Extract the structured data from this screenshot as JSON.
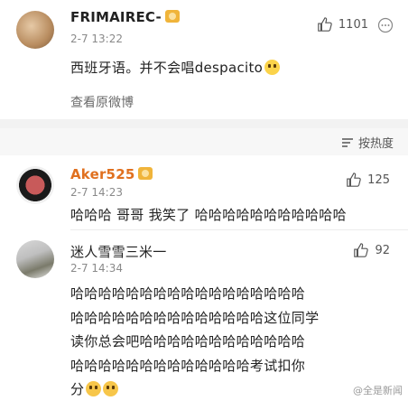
{
  "comments": [
    {
      "username": "FRIMAIREC-",
      "time": "2-7 13:22",
      "likes": "1101",
      "text": "西班牙语。并不会唱despacito",
      "view_original": "查看原微博"
    },
    {
      "username": "Aker525",
      "time": "2-7 14:23",
      "likes": "125",
      "text": "哈哈哈 哥哥 我笑了 哈哈哈哈哈哈哈哈哈哈哈"
    },
    {
      "username": "迷人雪雪三米一",
      "time": "2-7 14:34",
      "likes": "92",
      "text_lines": [
        "哈哈哈哈哈哈哈哈哈哈哈哈哈哈哈哈哈",
        "哈哈哈哈哈哈哈哈哈哈哈哈哈哈这位同学",
        "读你总会吧哈哈哈哈哈哈哈哈哈哈哈哈",
        "哈哈哈哈哈哈哈哈哈哈哈哈哈考试扣你",
        "分"
      ]
    }
  ],
  "sort_label": "按热度",
  "watermark": "@全是新闻",
  "icons": {
    "like": "thumbs-up-icon",
    "more": "more-icon",
    "sort": "sort-icon",
    "vip": "vip-badge-icon",
    "emoji": "emoji-icon"
  }
}
